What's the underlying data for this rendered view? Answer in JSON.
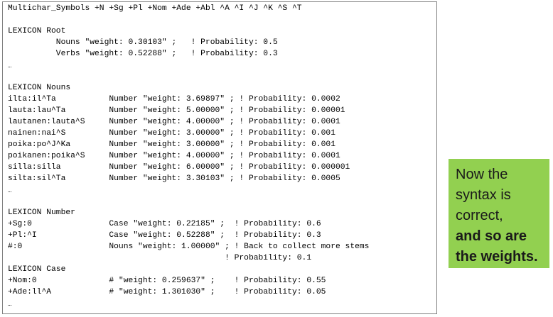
{
  "code": {
    "lines": [
      "Multichar_Symbols +N +Sg +Pl +Nom +Ade +Abl ^A ^I ^J ^K ^S ^T",
      "",
      "LEXICON Root",
      "          Nouns \"weight: 0.30103\" ;   ! Probability: 0.5",
      "          Verbs \"weight: 0.52288\" ;   ! Probability: 0.3",
      "…",
      "",
      "LEXICON Nouns",
      "ilta:il^Ta           Number \"weight: 3.69897\" ; ! Probability: 0.0002",
      "lauta:lau^Ta         Number \"weight: 5.00000\" ; ! Probability: 0.00001",
      "lautanen:lauta^S     Number \"weight: 4.00000\" ; ! Probability: 0.0001",
      "nainen:nai^S         Number \"weight: 3.00000\" ; ! Probability: 0.001",
      "poika:po^J^Ka        Number \"weight: 3.00000\" ; ! Probability: 0.001",
      "poikanen:poika^S     Number \"weight: 4.00000\" ; ! Probability: 0.0001",
      "silla:silla          Number \"weight: 6.00000\" ; ! Probability: 0.000001",
      "silta:sil^Ta         Number \"weight: 3.30103\" ; ! Probability: 0.0005",
      "…",
      "",
      "LEXICON Number",
      "+Sg:0                Case \"weight: 0.22185\" ;  ! Probability: 0.6",
      "+Pl:^I               Case \"weight: 0.52288\" ;  ! Probability: 0.3",
      "#:0                  Nouns \"weight: 1.00000\" ; ! Back to collect more stems",
      "                                             ! Probability: 0.1",
      "LEXICON Case",
      "+Nom:0               # \"weight: 0.259637\" ;    ! Probability: 0.55",
      "+Ade:ll^A            # \"weight: 1.301030\" ;    ! Probability: 0.05",
      "…"
    ]
  },
  "callout": {
    "line1": "Now the",
    "line2": "syntax is",
    "line3": "correct,",
    "line4": "and so are",
    "line5": "the weights.",
    "color": "#92d050"
  }
}
